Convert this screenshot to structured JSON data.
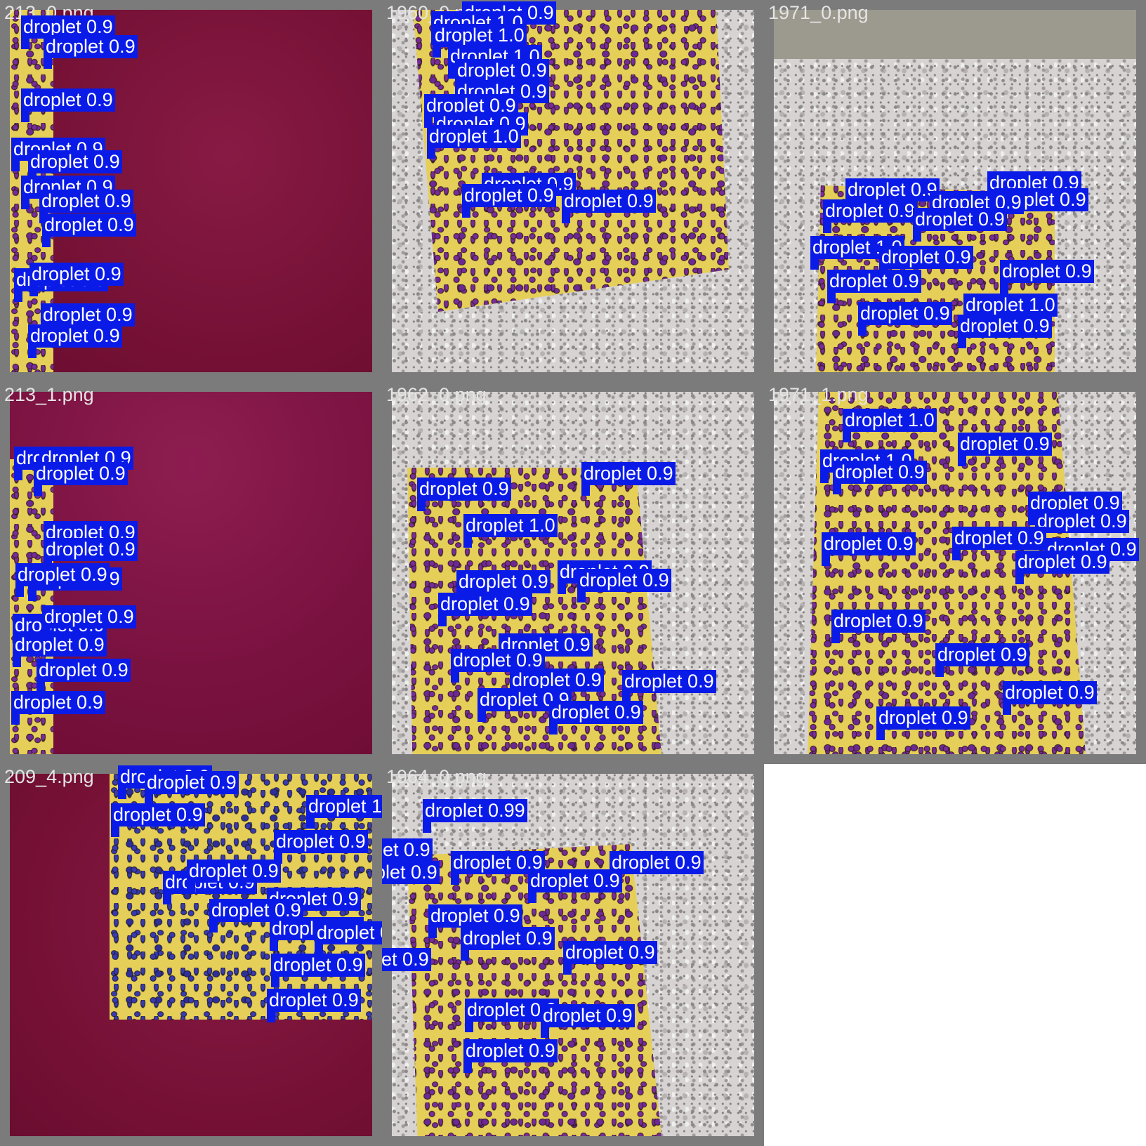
{
  "colors": {
    "label_bg": "#0a1be8",
    "label_text": "#ffffff",
    "frame": "#7b7b7b"
  },
  "tiles": [
    {
      "file": "213_0.png",
      "detections": [
        "droplet 0.9",
        "droplet 0.9",
        "droplet 0.9",
        "droplet 0.9",
        "droplet 0.9",
        "droplet 0.9",
        "droplet 0.9",
        "droplet 0.9",
        "droplet 0.9",
        "droplet 0.9",
        "droplet 0.9",
        "droplet 0.9",
        "droplet 0.9"
      ]
    },
    {
      "file": "1960_0.png",
      "detections": [
        "droplet 0.9",
        "droplet 1.0",
        "droplet 1.0",
        "droplet 1.0",
        "droplet 0.9",
        "droplet 0.9",
        "droplet 0.9",
        "droplet 0.9",
        "droplet 1.0",
        "droplet 0.9",
        "droplet 0.9",
        "droplet 0.9"
      ]
    },
    {
      "file": "1971_0.png",
      "detections": [
        "droplet 0.9",
        "droplet 0.9",
        "droplet 0.9",
        "droplet 0.9",
        "droplet 0.9",
        "droplet 0.9",
        "droplet 1.0",
        "droplet 0.9",
        "droplet 0.9",
        "droplet 0.9",
        "droplet 0.9",
        "droplet 1.0",
        "droplet 0.9"
      ]
    },
    {
      "file": "213_1.png",
      "detections": [
        "droplet 0.9",
        "droplet 0.9",
        "droplet 0.9",
        "droplet 0.9",
        "droplet 0.9",
        "droplet 0.9",
        "droplet 0.9",
        "droplet 0.9",
        "droplet 0.9",
        "droplet 0.9",
        "droplet 0.9",
        "droplet 0.9"
      ]
    },
    {
      "file": "1962_0.png",
      "detections": [
        "droplet 0.9",
        "droplet 0.9",
        "droplet 1.0",
        "droplet 0.9",
        "droplet 0.9",
        "droplet 0.9",
        "droplet 0.9",
        "droplet 0.9",
        "droplet 0.9",
        "droplet 0.9",
        "droplet 0.9",
        "droplet 0.9",
        "droplet 0.9"
      ]
    },
    {
      "file": "1971_1.png",
      "detections": [
        "droplet 1.0",
        "droplet 0.9",
        "droplet 1.0",
        "droplet 0.9",
        "droplet 0.9",
        "droplet 0.9",
        "droplet 0.9",
        "droplet 0.9",
        "droplet 0.9",
        "droplet 0.9",
        "droplet 0.9",
        "droplet 0.9",
        "droplet 0.9",
        "droplet 0.9"
      ]
    },
    {
      "file": "209_4.png",
      "detections": [
        "droplet 0.9",
        "droplet 0.9",
        "droplet 0.9",
        "droplet 1.0",
        "droplet 0.9",
        "droplet 0.9",
        "droplet 0.9",
        "droplet 0.9",
        "droplet 0.9",
        "droplet 0.9",
        "droplet 0.9",
        "droplet 0.9",
        "droplet 0.9"
      ]
    },
    {
      "file": "1964_0.png",
      "detections": [
        "droplet 0.99",
        "droplet 0.9",
        "droplet 0.9",
        "droplet 0.9",
        "droplet 0.9",
        "droplet 0.9",
        "droplet 0.9",
        "droplet 0.9",
        "droplet 0.9",
        "droplet 0.9",
        "droplet 0.9",
        "droplet 0.9",
        "droplet 0.9"
      ]
    }
  ]
}
